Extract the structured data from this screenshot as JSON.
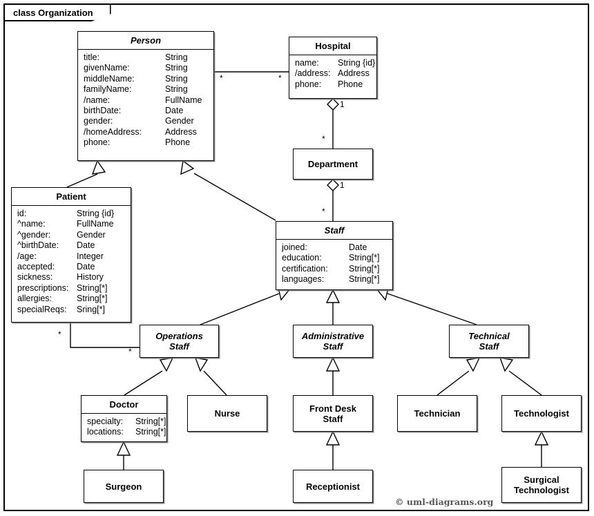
{
  "frame": {
    "label": "class Organization"
  },
  "copyright": "© uml-diagrams.org",
  "classes": {
    "person": {
      "name": "Person",
      "attrs": [
        {
          "name": "title:",
          "type": "String"
        },
        {
          "name": "givenName:",
          "type": "String"
        },
        {
          "name": "middleName:",
          "type": "String"
        },
        {
          "name": "familyName:",
          "type": "String"
        },
        {
          "name": "/name:",
          "type": "FullName"
        },
        {
          "name": "birthDate:",
          "type": "Date"
        },
        {
          "name": "gender:",
          "type": "Gender"
        },
        {
          "name": "/homeAddress:",
          "type": "Address"
        },
        {
          "name": "phone:",
          "type": "Phone"
        }
      ]
    },
    "hospital": {
      "name": "Hospital",
      "attrs": [
        {
          "name": "name:",
          "type": "String {id}"
        },
        {
          "name": "/address:",
          "type": "Address"
        },
        {
          "name": "phone:",
          "type": "Phone"
        }
      ]
    },
    "department": {
      "name": "Department"
    },
    "patient": {
      "name": "Patient",
      "attrs": [
        {
          "name": "id:",
          "type": "String {id}"
        },
        {
          "name": "^name:",
          "type": "FullName"
        },
        {
          "name": "^gender:",
          "type": "Gender"
        },
        {
          "name": "^birthDate:",
          "type": "Date"
        },
        {
          "name": "/age:",
          "type": "Integer"
        },
        {
          "name": "accepted:",
          "type": "Date"
        },
        {
          "name": "sickness:",
          "type": "History"
        },
        {
          "name": "prescriptions:",
          "type": "String[*]"
        },
        {
          "name": "allergies:",
          "type": "String[*]"
        },
        {
          "name": "specialReqs:",
          "type": "Sring[*]"
        }
      ]
    },
    "staff": {
      "name": "Staff",
      "attrs": [
        {
          "name": "joined:",
          "type": "Date"
        },
        {
          "name": "education:",
          "type": "String[*]"
        },
        {
          "name": "certification:",
          "type": "String[*]"
        },
        {
          "name": "languages:",
          "type": "String[*]"
        }
      ]
    },
    "operations_staff": {
      "name": "Operations\nStaff"
    },
    "administrative_staff": {
      "name": "Administrative\nStaff"
    },
    "technical_staff": {
      "name": "Technical\nStaff"
    },
    "doctor": {
      "name": "Doctor",
      "attrs": [
        {
          "name": "specialty:",
          "type": "String[*]"
        },
        {
          "name": "locations:",
          "type": "String[*]"
        }
      ]
    },
    "nurse": {
      "name": "Nurse"
    },
    "front_desk_staff": {
      "name": "Front Desk\nStaff"
    },
    "technician": {
      "name": "Technician"
    },
    "technologist": {
      "name": "Technologist"
    },
    "surgeon": {
      "name": "Surgeon"
    },
    "receptionist": {
      "name": "Receptionist"
    },
    "surgical_technologist": {
      "name": "Surgical\nTechnologist"
    }
  },
  "multiplicities": {
    "person_hospital_person_end": "*",
    "person_hospital_hospital_end": "*",
    "hospital_department_hospital_end": "1",
    "hospital_department_department_end": "*",
    "department_staff_department_end": "1",
    "department_staff_staff_end": "*",
    "patient_operations_patient_end": "*",
    "patient_operations_operations_end": "*"
  }
}
